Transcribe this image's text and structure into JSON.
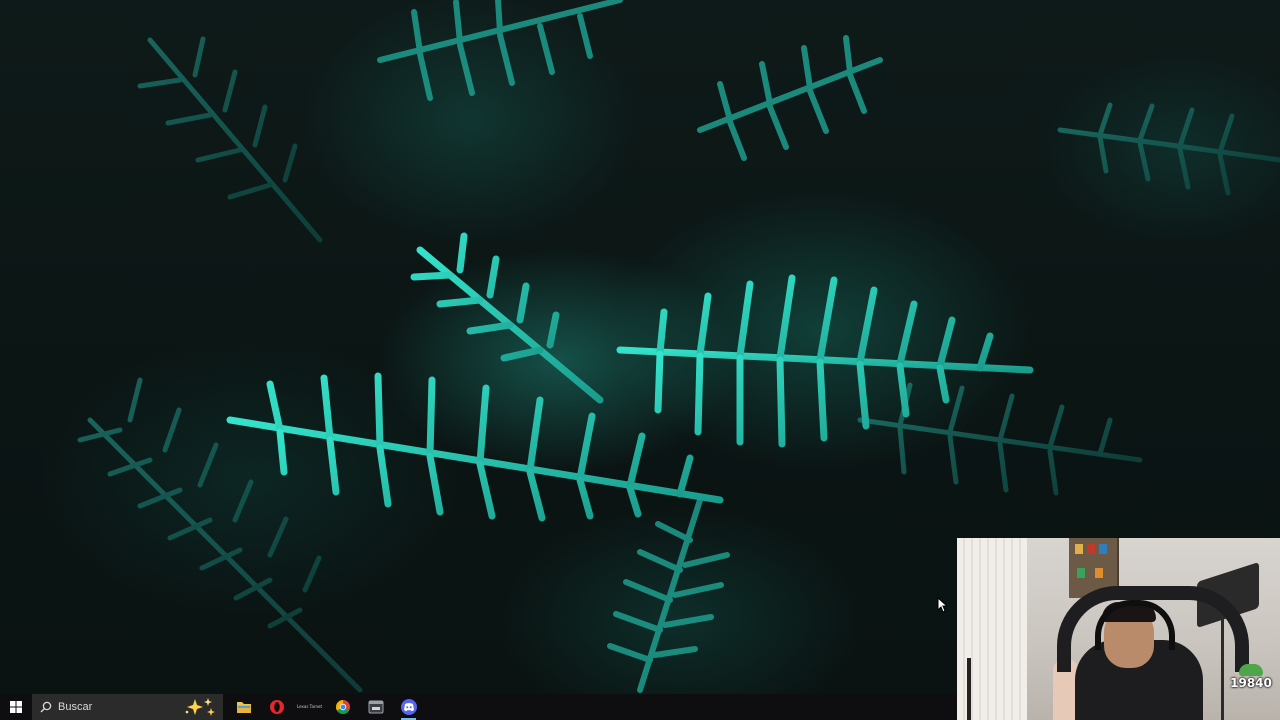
{
  "wallpaper": {
    "description_colors": {
      "accent": "#2ee0c8",
      "dark": "#0b1514"
    }
  },
  "taskbar": {
    "start_icon": "windows-logo-icon",
    "search": {
      "placeholder": "Buscar",
      "icon": "search-icon",
      "highlight_icon": "sparkle-icon"
    },
    "apps": [
      {
        "name": "file-explorer",
        "icon": "folder-icon",
        "color": "#f4c542"
      },
      {
        "name": "opera",
        "icon": "opera-icon",
        "color": "#e8262c"
      },
      {
        "name": "pinned-shortcut",
        "icon": "shortcut-icon",
        "label": "Lexas Tarnet"
      },
      {
        "name": "chrome",
        "icon": "chrome-icon",
        "color": "#4caf50"
      },
      {
        "name": "app-window",
        "icon": "window-app-icon",
        "color": "#9aa0a6"
      },
      {
        "name": "discord",
        "icon": "discord-icon",
        "color": "#5865f2",
        "active": true
      }
    ]
  },
  "webcam": {
    "points_value": "19840"
  }
}
